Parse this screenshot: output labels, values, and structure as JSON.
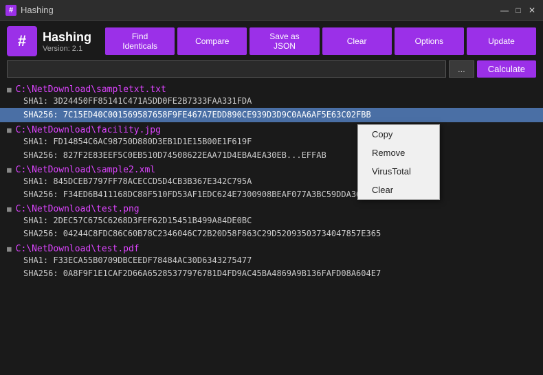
{
  "titlebar": {
    "icon": "#",
    "title": "Hashing",
    "controls": {
      "minimize": "—",
      "maximize": "□",
      "close": "✕"
    }
  },
  "header": {
    "logo_char": "#",
    "app_name": "Hashing",
    "app_version": "Version: 2.1",
    "toolbar": {
      "find_identicals": "Find Identicals",
      "compare": "Compare",
      "save_as_json": "Save as JSON",
      "clear": "Clear",
      "options": "Options",
      "update": "Update"
    },
    "search": {
      "placeholder": "",
      "browse_label": "...",
      "calculate_label": "Calculate"
    }
  },
  "files": [
    {
      "path": "C:\\NetDownload\\sampletxt.txt",
      "hashes": [
        {
          "label": "SHA1:",
          "value": "3D24450FF85141C471A5DD0FE2B7333FAA331FDA",
          "highlighted": false
        },
        {
          "label": "SHA256:",
          "value": "7C15ED40C001569587658F9FE467A7EDD890CE939D3D9C0AA6AF5E63C02FBB",
          "highlighted": true
        }
      ]
    },
    {
      "path": "C:\\NetDownload\\facility.jpg",
      "hashes": [
        {
          "label": "SHA1:",
          "value": "FD14854C6AC98750D880D3EB1D1E15B00E1F619F",
          "highlighted": false
        },
        {
          "label": "SHA256:",
          "value": "827F2E83EEF5C0EB510D74508622EAA71D4EBA4EA30EB...EFFAB",
          "highlighted": false
        }
      ]
    },
    {
      "path": "C:\\NetDownload\\sample2.xml",
      "hashes": [
        {
          "label": "SHA1:",
          "value": "845DCEB7797FF78ACECCD5D4CB3B367E342C795A",
          "highlighted": false
        },
        {
          "label": "SHA256:",
          "value": "F34ED6B411168DC88F510FD53AF1EDC624E7300908BEAF077A3BC59DDA36681E",
          "highlighted": false
        }
      ]
    },
    {
      "path": "C:\\NetDownload\\test.png",
      "hashes": [
        {
          "label": "SHA1:",
          "value": "2DEC57C675C6268D3FEF62D15451B499A84DE0BC",
          "highlighted": false
        },
        {
          "label": "SHA256:",
          "value": "04244C8FDC86C60B78C2346046C72B20D58F863C29D52093503734047857E365",
          "highlighted": false
        }
      ]
    },
    {
      "path": "C:\\NetDownload\\test.pdf",
      "hashes": [
        {
          "label": "SHA1:",
          "value": "F33ECA55B0709DBCEEDF78484AC30D6343275477",
          "highlighted": false
        },
        {
          "label": "SHA256:",
          "value": "0A8F9F1E1CAF2D66A65285377976781D4FD9AC45BA4869A9B136FAFD08A604E7",
          "highlighted": false
        }
      ]
    }
  ],
  "context_menu": {
    "items": [
      {
        "id": "copy",
        "label": "Copy"
      },
      {
        "id": "remove",
        "label": "Remove"
      },
      {
        "id": "virustotal",
        "label": "VirusTotal"
      },
      {
        "id": "clear",
        "label": "Clear"
      }
    ]
  }
}
